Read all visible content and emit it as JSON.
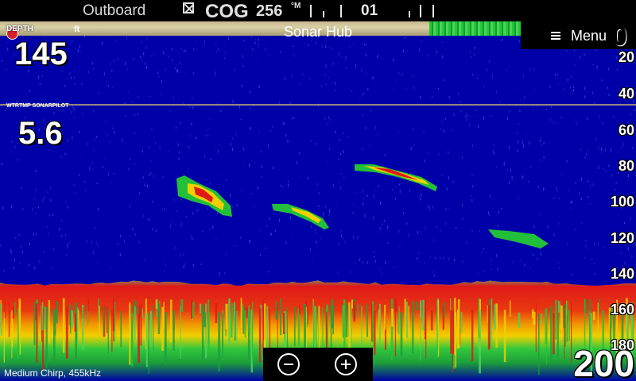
{
  "status_bar": {
    "source": "Outboard",
    "cog_label": "COG",
    "cog_value": "256",
    "cog_unit": "°M",
    "heading": "01"
  },
  "title": "Sonar Hub",
  "menu": {
    "label": "Menu",
    "icon": "hamburger-icon"
  },
  "depth": {
    "label": "DEPTH",
    "unit": "ft",
    "value": "145"
  },
  "temperature": {
    "label": "WTRTMP SONARPILOT",
    "value": "5.6"
  },
  "depth_scale": {
    "top": "0",
    "labels": [
      "20",
      "40",
      "60",
      "80",
      "100",
      "120",
      "140",
      "160",
      "180"
    ]
  },
  "range": "200",
  "frequency": "Medium Chirp, 455kHz",
  "zoom": {
    "out_icon": "minus-icon",
    "in_icon": "plus-icon"
  },
  "colors": {
    "water": "#0000a8",
    "bottom_red": "#e01818",
    "bottom_yellow": "#f0d000",
    "return_green": "#22c03a"
  }
}
